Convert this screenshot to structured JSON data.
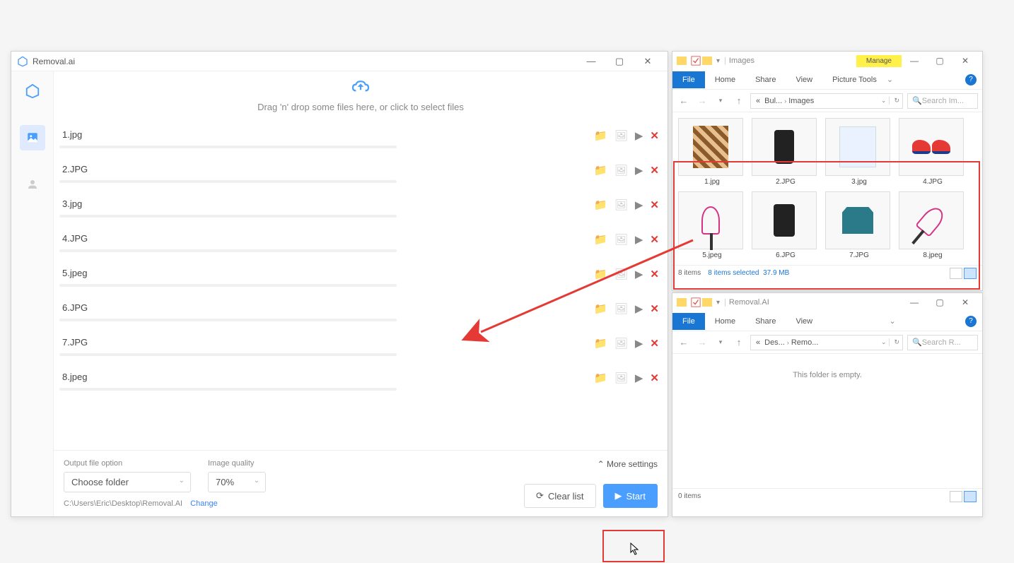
{
  "app": {
    "title": "Removal.ai",
    "dropzone_text": "Drag 'n' drop some files here, or click to select files",
    "files": [
      {
        "name": "1.jpg"
      },
      {
        "name": "2.JPG"
      },
      {
        "name": "3.jpg"
      },
      {
        "name": "4.JPG"
      },
      {
        "name": "5.jpeg"
      },
      {
        "name": "6.JPG"
      },
      {
        "name": "7.JPG"
      },
      {
        "name": "8.jpeg"
      }
    ],
    "output_label": "Output file option",
    "output_value": "Choose folder",
    "quality_label": "Image quality",
    "quality_value": "70%",
    "path": "C:\\Users\\Eric\\Desktop\\Removal.AI",
    "change_label": "Change",
    "more_label": "More settings",
    "clear_label": "Clear list",
    "start_label": "Start"
  },
  "explorer1": {
    "title": "Images",
    "manage": "Manage",
    "tabs": {
      "file": "File",
      "home": "Home",
      "share": "Share",
      "view": "View",
      "picture": "Picture Tools"
    },
    "breadcrumb": {
      "prefix": "«",
      "a": "Bul...",
      "b": "Images"
    },
    "search_placeholder": "Search Im...",
    "thumbs": [
      {
        "name": "1.jpg"
      },
      {
        "name": "2.JPG"
      },
      {
        "name": "3.jpg"
      },
      {
        "name": "4.JPG"
      },
      {
        "name": "5.jpeg"
      },
      {
        "name": "6.JPG"
      },
      {
        "name": "7.JPG"
      },
      {
        "name": "8.jpeg"
      }
    ],
    "status_items": "8 items",
    "status_selected": "8 items selected",
    "status_size": "37.9 MB"
  },
  "explorer2": {
    "title": "Removal.AI",
    "tabs": {
      "file": "File",
      "home": "Home",
      "share": "Share",
      "view": "View"
    },
    "breadcrumb": {
      "prefix": "«",
      "a": "Des...",
      "b": "Remo..."
    },
    "search_placeholder": "Search R...",
    "empty": "This folder is empty.",
    "status_items": "0 items"
  }
}
